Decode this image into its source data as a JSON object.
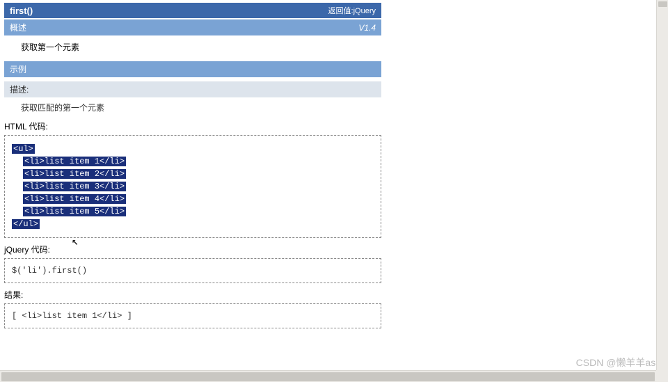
{
  "header": {
    "title": "first()",
    "returnLabel": "返回值:jQuery"
  },
  "overview": {
    "label": "概述",
    "version": "V1.4"
  },
  "description": "获取第一个元素",
  "example": {
    "label": "示例",
    "descLabel": "描述:",
    "descText": "获取匹配的第一个元素"
  },
  "sections": {
    "htmlLabel": "HTML 代码:",
    "jqueryLabel": "jQuery 代码:",
    "resultLabel": "结果:"
  },
  "htmlCode": {
    "open": "<ul>",
    "li1": "<li>list item 1</li>",
    "li2": "<li>list item 2</li>",
    "li3": "<li>list item 3</li>",
    "li4": "<li>list item 4</li>",
    "li5": "<li>list item 5</li>",
    "close": "</ul>"
  },
  "jqueryCode": "$('li').first()",
  "resultCode": "[ <li>list item 1</li> ]",
  "watermark": "CSDN @懒羊羊asd"
}
